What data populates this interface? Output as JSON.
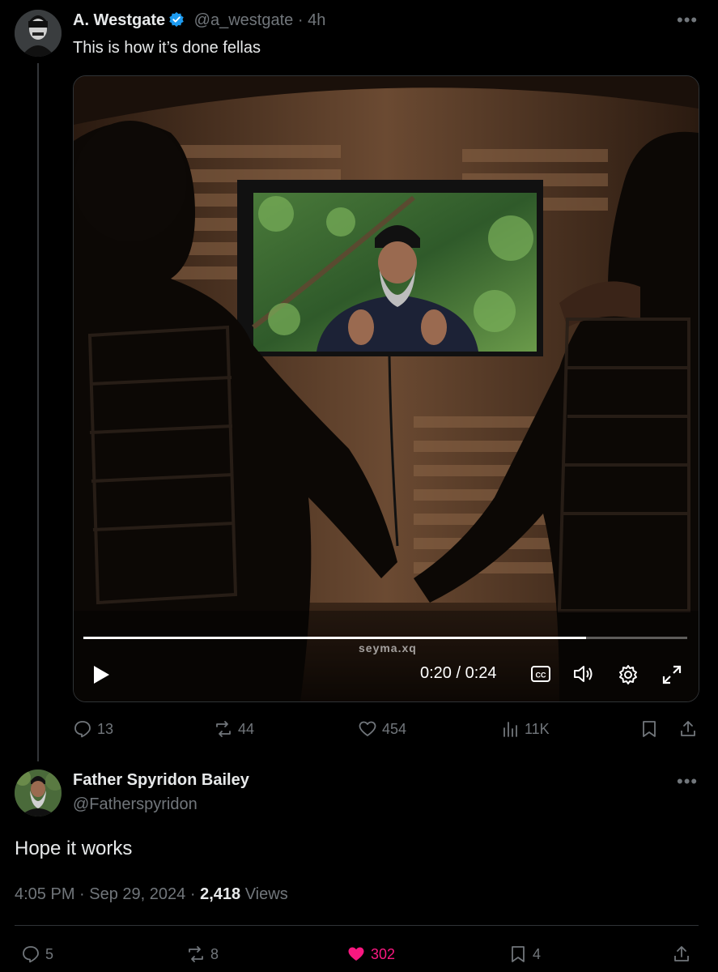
{
  "original_post": {
    "author_name": "A. Westgate",
    "handle": "@a_westgate",
    "separator": "·",
    "time": "4h",
    "text": "This is how it’s done fellas",
    "video": {
      "watermark": "seyma.xq",
      "time_display": "0:20 / 0:24",
      "progress_fraction": 0.833
    },
    "stats": {
      "replies": "13",
      "reposts": "44",
      "likes": "454",
      "views": "11K"
    }
  },
  "reply": {
    "author_name": "Father Spyridon Bailey",
    "handle": "@Fatherspyridon",
    "text": "Hope it works",
    "time": "4:05 PM",
    "date": "Sep 29, 2024",
    "views_count": "2,418",
    "views_label": "Views",
    "separator": "·",
    "stats": {
      "replies": "5",
      "reposts": "8",
      "likes": "302",
      "bookmarks": "4"
    }
  },
  "colors": {
    "background": "#000000",
    "text": "#e7e9ea",
    "muted": "#71767b",
    "verified": "#1d9bf0",
    "like_active": "#f91880"
  }
}
